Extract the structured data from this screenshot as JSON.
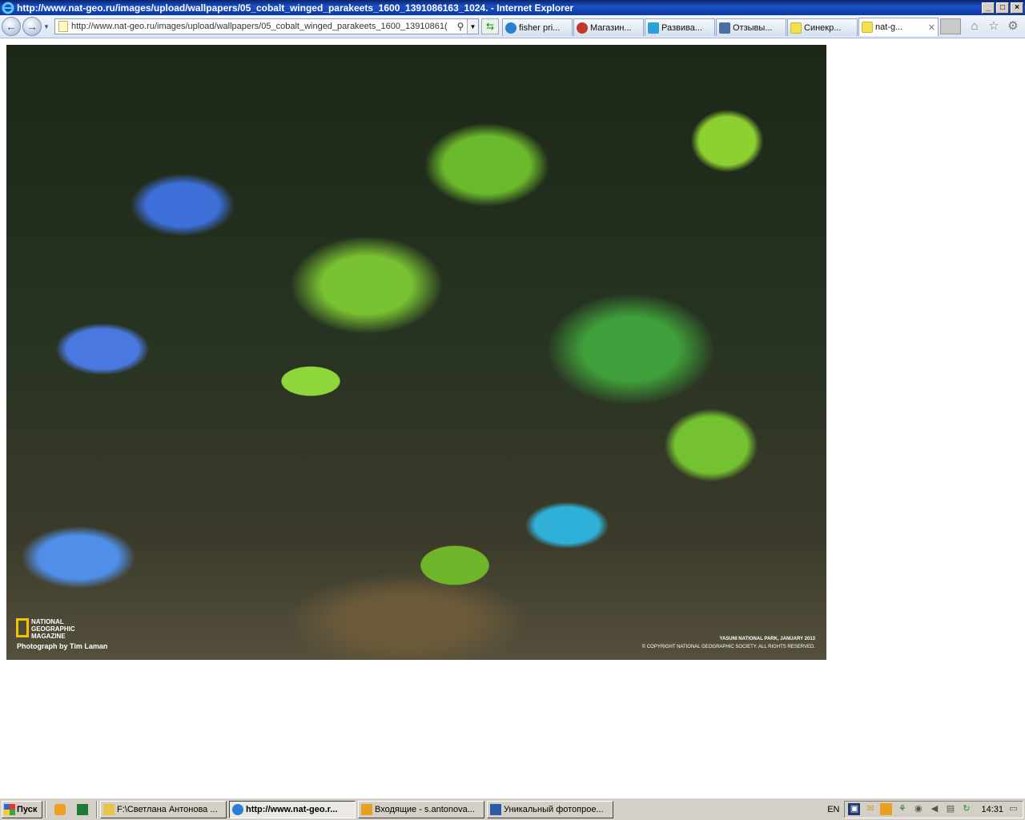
{
  "window": {
    "title": "http://www.nat-geo.ru/images/upload/wallpapers/05_cobalt_winged_parakeets_1600_1391086163_1024. - Internet Explorer"
  },
  "address": {
    "url": "http://www.nat-geo.ru/images/upload/wallpapers/05_cobalt_winged_parakeets_1600_13910861("
  },
  "tabs": [
    {
      "label": "fisher pri...",
      "icon": "ie-icon",
      "color": "#2a7fd4"
    },
    {
      "label": "Магазин...",
      "icon": "shop-icon",
      "color": "#c0392b"
    },
    {
      "label": "Развива...",
      "icon": "b-icon",
      "color": "#2a9fd8"
    },
    {
      "label": "Отзывы...",
      "icon": "review-icon",
      "color": "#4a6fa5"
    },
    {
      "label": "Синекр...",
      "icon": "page-icon",
      "color": "#f2e24a"
    },
    {
      "label": "nat-g...",
      "icon": "page-icon",
      "color": "#f2e24a"
    }
  ],
  "wallpaper": {
    "logo_line1": "NATIONAL",
    "logo_line2": "GEOGRAPHIC",
    "logo_line3": "MAGAZINE",
    "credit": "Photograph by Tim Laman",
    "location": "YASUNI NATIONAL PARK, JANUARY 2013",
    "copyright": "© COPYRIGHT NATIONAL GEOGRAPHIC SOCIETY. ALL RIGHTS RESERVED."
  },
  "taskbar": {
    "start_label": "Пуск",
    "buttons": [
      {
        "label": "F:\\Светлана Антонова ...",
        "icon": "folder-icon",
        "color": "#e8c44a"
      },
      {
        "label": "http://www.nat-geo.r...",
        "icon": "ie-icon",
        "color": "#2a7fd4",
        "active": true
      },
      {
        "label": "Входящие - s.antonova...",
        "icon": "outlook-icon",
        "color": "#e8a020"
      },
      {
        "label": "Уникальный фотопрое...",
        "icon": "word-icon",
        "color": "#2a5aa8"
      }
    ],
    "language": "EN",
    "clock": "14:31"
  }
}
